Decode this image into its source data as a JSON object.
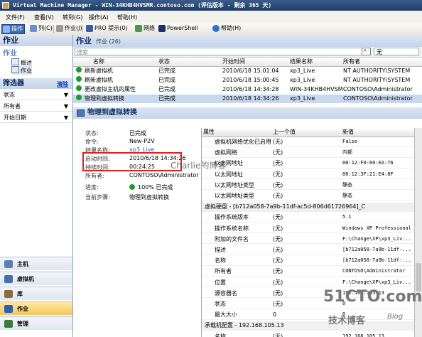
{
  "window": {
    "title": "Virtual Machine Manager - WIN-34KHB4HVSMR.contoso.com (评估版本 - 剩余 365 天)"
  },
  "menu": [
    "文件(F)",
    "查看(V)",
    "转到(G)",
    "操作(A)",
    "帮助(H)"
  ],
  "toolbar": {
    "items": [
      {
        "label": "操作",
        "icon": "actions-icon",
        "color": "#2f6fd0"
      },
      {
        "label": "列(C)",
        "icon": "columns-icon",
        "color": "#6b8fc6"
      },
      {
        "label": "作业(J)",
        "icon": "jobs-icon",
        "color": "#888"
      },
      {
        "label": "PRO 提示(0)",
        "icon": "pro-tips-icon",
        "color": "#3a5fa0"
      },
      {
        "label": "网络",
        "icon": "network-icon",
        "color": "#4a9a4a"
      },
      {
        "label": "PowerShell",
        "icon": "powershell-icon",
        "color": "#1a2f6a"
      },
      {
        "label": "帮助(H)",
        "icon": "help-icon",
        "color": "#2f6fd0"
      }
    ]
  },
  "sidebar": {
    "header": "作业",
    "tree_root": "作业",
    "tree_items": [
      "概述",
      "作业"
    ],
    "filter_title": "筛选器",
    "filter_clear": "清除",
    "filters": [
      "状态",
      "所有者",
      "开始日期"
    ],
    "workspaces": [
      {
        "label": "主机",
        "icon": "hosts-icon",
        "color": "#5b7fb5"
      },
      {
        "label": "虚拟机",
        "icon": "virtual-machines-icon",
        "color": "#4a6fa5"
      },
      {
        "label": "库",
        "icon": "library-icon",
        "color": "#8a6d3b"
      },
      {
        "label": "作业",
        "icon": "jobs-icon",
        "color": "#2f5fb0"
      },
      {
        "label": "管理",
        "icon": "administration-icon",
        "color": "#3a7a3a"
      }
    ]
  },
  "main": {
    "title": "作业",
    "count": "作业 (26)",
    "search_placeholder": "搜索",
    "filter_value": "无",
    "columns": [
      "名称",
      "状态",
      "开始时间",
      "结果名称",
      "所有者"
    ],
    "rows": [
      {
        "name": "刷新虚拟机",
        "status": "已完成",
        "start": "2010/6/18 15:01:04",
        "result": "xp3_Live",
        "owner": "NT AUTHORITY\\SYSTEM"
      },
      {
        "name": "刷新虚拟机",
        "status": "已完成",
        "start": "2010/6/18 15:00:45",
        "result": "xp3_Live",
        "owner": "NT AUTHORITY\\SYSTEM"
      },
      {
        "name": "更改虚拟主机的属性",
        "status": "已完成",
        "start": "2010/6/18 14:34:28",
        "result": "WIN-34KHB4HVSMR...",
        "owner": "CONTOSO\\Administrator"
      },
      {
        "name": "物理到虚拟转换",
        "status": "已完成",
        "start": "2010/6/18 14:34:26",
        "result": "xp3_Live",
        "owner": "CONTOSO\\Administrator"
      }
    ]
  },
  "detail": {
    "title": "物理到虚拟转换",
    "labels": [
      "状态:",
      "命令:",
      "结果名称:",
      "启动时间:",
      "持续时间:",
      "所有者:",
      "进度:",
      "当前步骤:"
    ],
    "values": [
      "已完成",
      "New-P2V",
      "xp3_Live",
      "2010/6/18 14:34:26",
      "00:24:25",
      "CONTOSO\\Administrator",
      "100% 已完成",
      "物理到虚拟转换"
    ],
    "watermark": "Charlie的博客"
  },
  "properties": {
    "columns": [
      "属性",
      "上一个值",
      "新值"
    ],
    "rows": [
      {
        "name": "虚拟机网络优化已启用",
        "old": "(无)",
        "new": "False"
      },
      {
        "name": "虚拟网络",
        "old": "(无)",
        "new": "内部"
      },
      {
        "name": "以太网地址",
        "old": "(无)",
        "new": "00:12:F0:60:EA:76"
      },
      {
        "name": "以太网地址",
        "old": "(无)",
        "new": "00:12:3F:21:E4:8F"
      },
      {
        "name": "以太网地址类型",
        "old": "(无)",
        "new": "静态"
      },
      {
        "name": "以太网地址类型",
        "old": "(无)",
        "new": "静态"
      },
      {
        "group": "虚拟硬盘 - [b712a058-7a9b-11df-ac5d-806d61726964]_C"
      },
      {
        "name": "操作系统版本",
        "old": "(无)",
        "new": "5.1"
      },
      {
        "name": "操作系统名称",
        "old": "(无)",
        "new": "Windows XP Professional"
      },
      {
        "name": "附加的文件名",
        "old": "(无)",
        "new": "F:\\Change\\XP\\xp3_Liv..."
      },
      {
        "name": "描述",
        "old": "(无)",
        "new": "[b712a058-7a9b-11df-..."
      },
      {
        "name": "名称",
        "old": "(无)",
        "new": "[b712a058-7a9b-11df-..."
      },
      {
        "name": "所有者",
        "old": "(无)",
        "new": "CONTOSO\\Administrator"
      },
      {
        "name": "位置",
        "old": "(无)",
        "new": "F:\\Change\\XP\\xp3_Liv..."
      },
      {
        "name": "源容器名",
        "old": "(无)",
        "new": "192.168.105.13"
      },
      {
        "name": "状态",
        "old": "(无)",
        "new": "0"
      },
      {
        "name": "最大大小",
        "old": "0",
        "new": "0"
      },
      {
        "group": "承载机配置 - 192.168.105.13"
      },
      {
        "name": "名称",
        "old": "(无)",
        "new": "192.168.105.13"
      }
    ]
  },
  "branding": {
    "logo": "51CTO.com",
    "sub": "技术博客",
    "blog": "Blog"
  }
}
